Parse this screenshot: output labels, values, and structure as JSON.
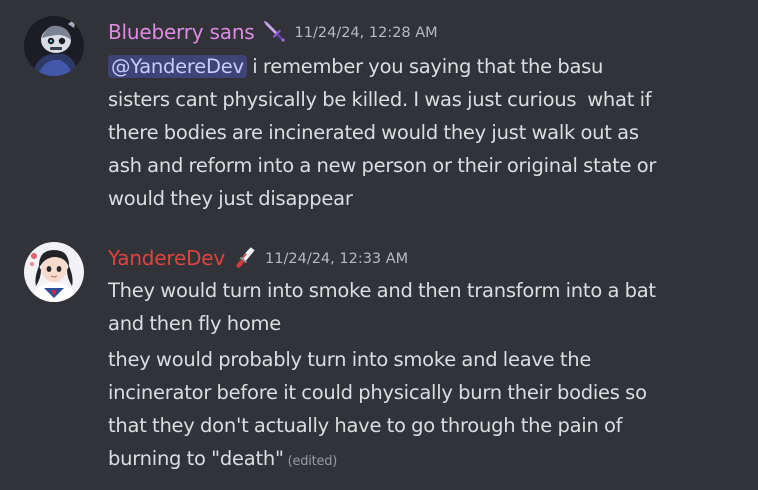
{
  "messages": [
    {
      "author": "Blueberry sans",
      "author_color": "#e08ae6",
      "role_icon": "dagger-icon",
      "timestamp": "11/24/24, 12:28 AM",
      "mention": "@YandereDev",
      "lines": [
        " i remember you saying that the basu",
        "sisters cant physically be killed. I was just curious  what if",
        "there bodies are incinerated would they just walk out as",
        "ash and reform into a new person or their original state or",
        "would they just disappear"
      ]
    },
    {
      "author": "YandereDev",
      "author_color": "#e0433f",
      "role_icon": "knife-icon",
      "timestamp": "11/24/24, 12:33 AM",
      "paragraph1": [
        "They would turn into smoke and then transform into a bat",
        "and then fly home"
      ],
      "paragraph2": [
        "they would probably turn into smoke and leave the",
        "incinerator before it could physically burn their bodies so",
        "that they don't actually have to go through the pain of",
        "burning to \"death\""
      ],
      "edited_label": "(edited)"
    }
  ]
}
